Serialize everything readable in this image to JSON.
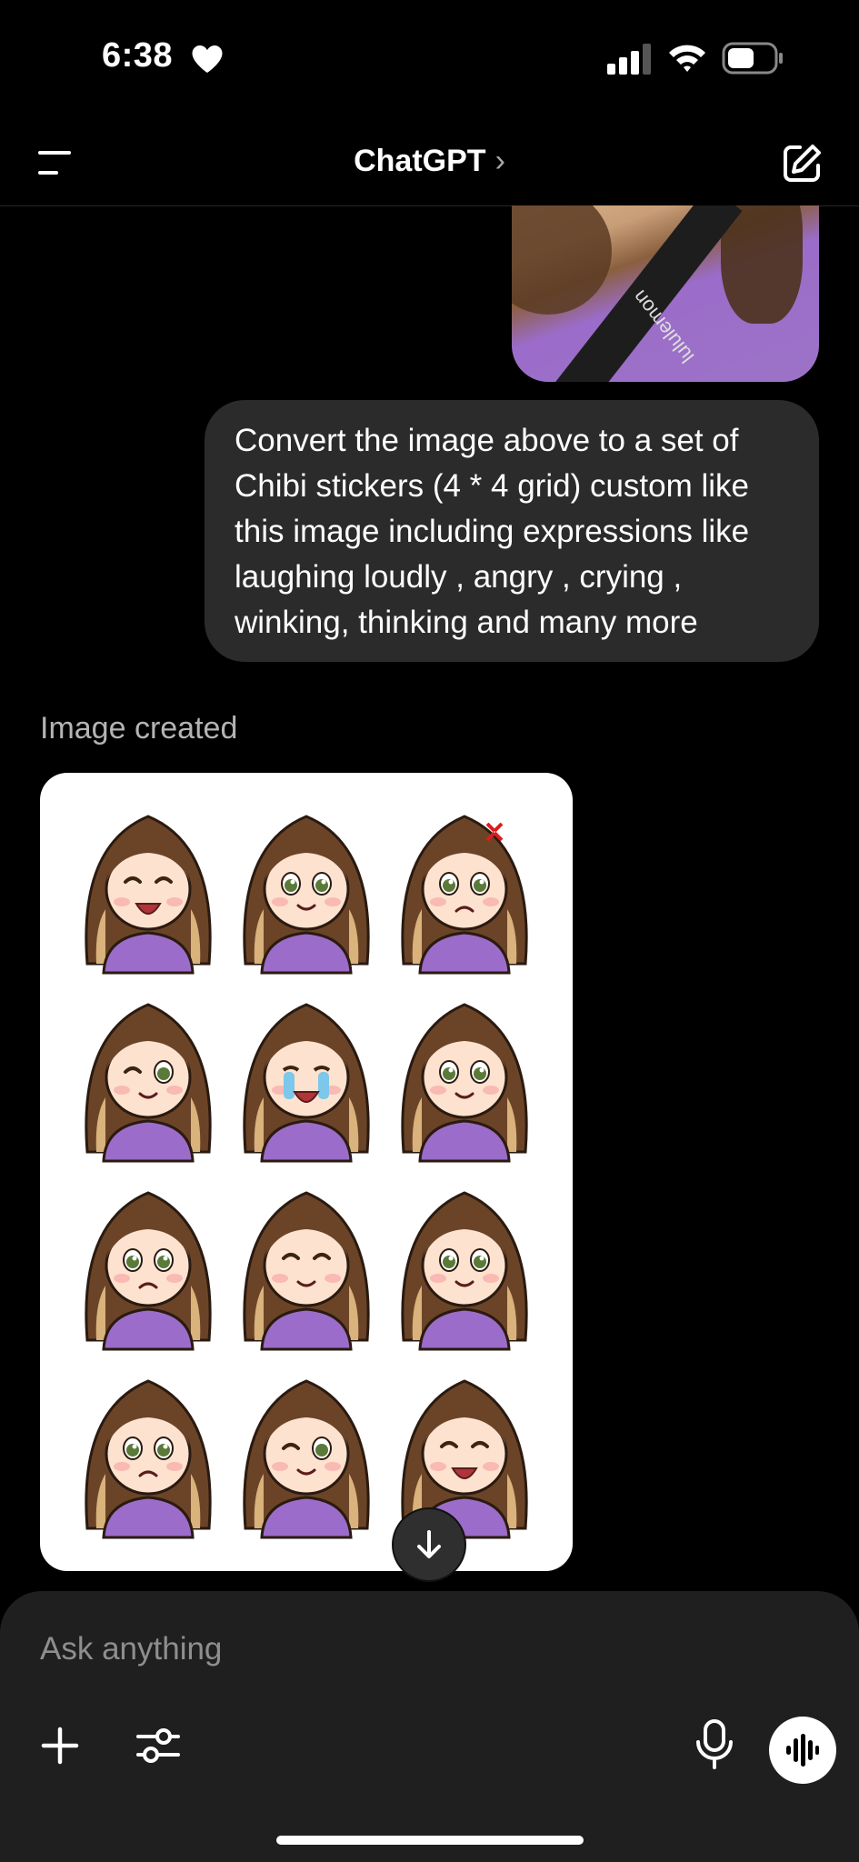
{
  "status_bar": {
    "time": "6:38"
  },
  "header": {
    "title": "ChatGPT",
    "chevron": "›"
  },
  "conversation": {
    "photo_caption_text": "lululemon",
    "user_message": "Convert the image above to a set of Chibi stickers (4 * 4 grid) custom like this image including expressions like laughing loudly , angry , crying , winking, thinking and many more",
    "assistant_label": "Image created",
    "stickers": [
      {
        "expression": "laughing"
      },
      {
        "expression": "smiling"
      },
      {
        "expression": "angry"
      },
      {
        "expression": "winking"
      },
      {
        "expression": "crying"
      },
      {
        "expression": "thinking"
      },
      {
        "expression": "pouting"
      },
      {
        "expression": "blushing"
      },
      {
        "expression": "wondering"
      },
      {
        "expression": "teary"
      },
      {
        "expression": "winking-arms-crossed"
      },
      {
        "expression": "laughing-eyes-closed"
      }
    ]
  },
  "composer": {
    "placeholder": "Ask anything"
  },
  "icons": {
    "menu": "menu-icon",
    "compose": "compose-icon",
    "plus": "plus-icon",
    "tools": "sliders-icon",
    "mic": "mic-icon",
    "voice": "voice-wave-icon",
    "scroll": "arrow-down-icon"
  },
  "colors": {
    "background": "#000000",
    "bubble": "#2b2b2b",
    "composer": "#1f1f1f",
    "shirt": "#9b6cc9"
  }
}
